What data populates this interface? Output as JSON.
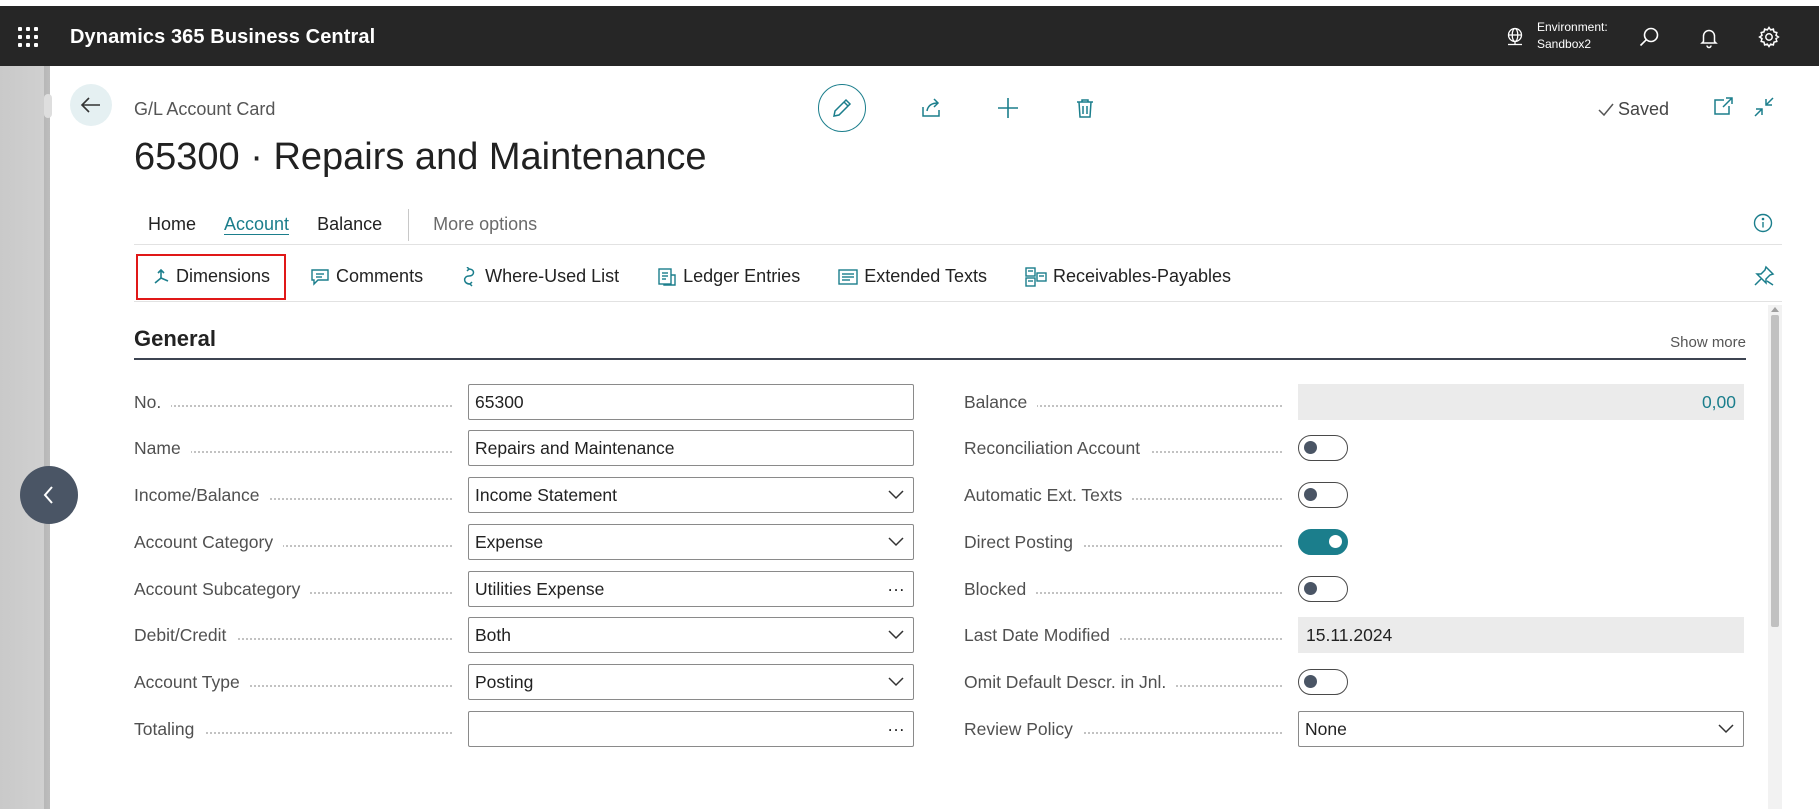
{
  "app": {
    "title": "Dynamics 365 Business Central"
  },
  "topbar": {
    "environment_label": "Environment:",
    "environment_name": "Sandbox2"
  },
  "page": {
    "breadcrumb": "G/L Account Card",
    "title": "65300 · Repairs and Maintenance",
    "saved_label": "Saved"
  },
  "tabs": [
    {
      "label": "Home",
      "active": false
    },
    {
      "label": "Account",
      "active": true
    },
    {
      "label": "Balance",
      "active": false
    },
    {
      "label": "More options",
      "active": false
    }
  ],
  "actions": [
    {
      "label": "Dimensions",
      "icon": "dimensions-icon",
      "highlighted": true
    },
    {
      "label": "Comments",
      "icon": "comment-icon"
    },
    {
      "label": "Where-Used List",
      "icon": "where-used-icon"
    },
    {
      "label": "Ledger Entries",
      "icon": "ledger-entries-icon"
    },
    {
      "label": "Extended Texts",
      "icon": "list-icon"
    },
    {
      "label": "Receivables-Payables",
      "icon": "receivables-icon"
    }
  ],
  "section": {
    "title": "General",
    "show_more": "Show more"
  },
  "left_fields": [
    {
      "label": "No.",
      "value": "65300",
      "control": "text"
    },
    {
      "label": "Name",
      "value": "Repairs and Maintenance",
      "control": "text"
    },
    {
      "label": "Income/Balance",
      "value": "Income Statement",
      "control": "dropdown"
    },
    {
      "label": "Account Category",
      "value": "Expense",
      "control": "dropdown"
    },
    {
      "label": "Account Subcategory",
      "value": "Utilities Expense",
      "control": "lookup"
    },
    {
      "label": "Debit/Credit",
      "value": "Both",
      "control": "dropdown"
    },
    {
      "label": "Account Type",
      "value": "Posting",
      "control": "dropdown"
    },
    {
      "label": "Totaling",
      "value": "",
      "control": "lookup"
    }
  ],
  "right_fields": [
    {
      "label": "Balance",
      "value": "0,00",
      "control": "readonly-number"
    },
    {
      "label": "Reconciliation Account",
      "value": false,
      "control": "toggle"
    },
    {
      "label": "Automatic Ext. Texts",
      "value": false,
      "control": "toggle"
    },
    {
      "label": "Direct Posting",
      "value": true,
      "control": "toggle"
    },
    {
      "label": "Blocked",
      "value": false,
      "control": "toggle"
    },
    {
      "label": "Last Date Modified",
      "value": "15.11.2024",
      "control": "readonly"
    },
    {
      "label": "Omit Default Descr. in Jnl.",
      "value": false,
      "control": "toggle"
    },
    {
      "label": "Review Policy",
      "value": "None",
      "control": "dropdown"
    }
  ],
  "lookup_glyph": "···",
  "colors": {
    "accent": "#1b7e8c",
    "topbar": "#262626",
    "highlight": "#e01818"
  }
}
